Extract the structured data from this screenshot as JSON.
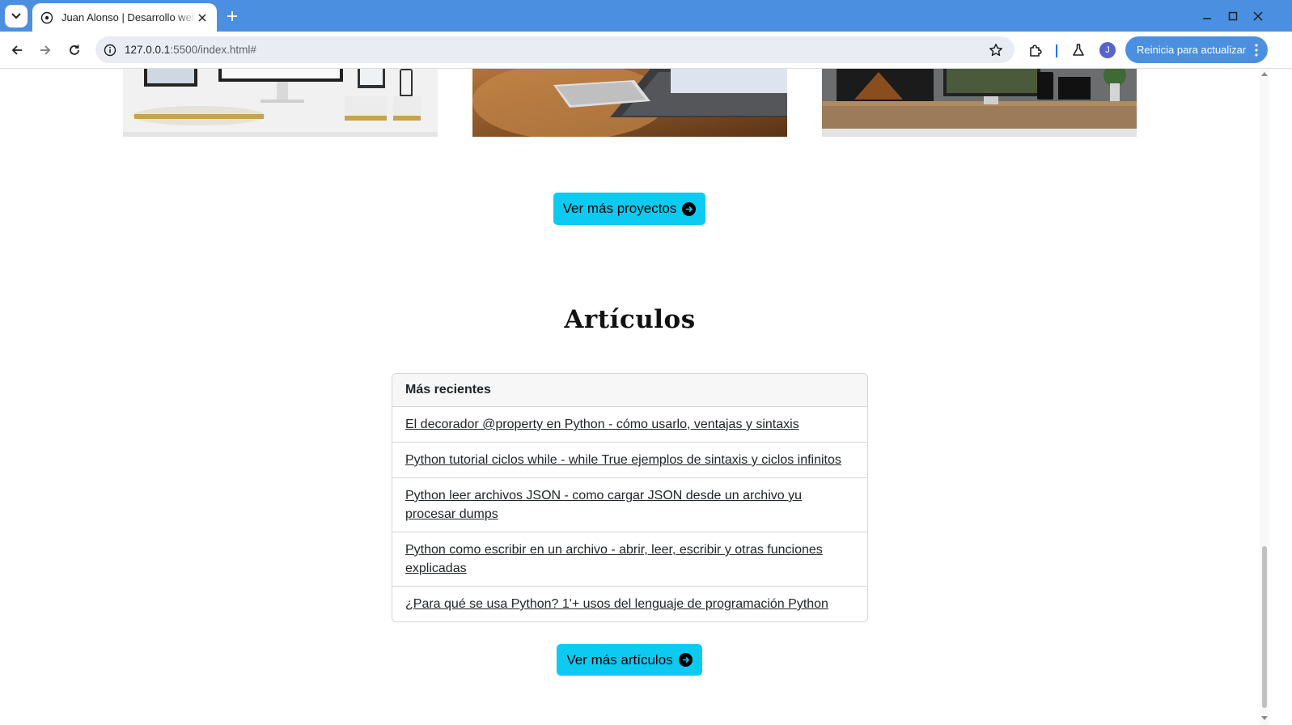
{
  "browser": {
    "tab_title": "Juan Alonso | Desarrollo web",
    "url_host": "127.0.0.1",
    "url_rest": ":5500/index.html#",
    "avatar_letter": "J",
    "update_label": "Reinicia para actualizar"
  },
  "projects": {
    "more_button": "Ver más proyectos"
  },
  "articles": {
    "title": "Artículos",
    "card_header": "Más recientes",
    "items": [
      "El decorador @property en Python - cómo usarlo, ventajas y sintaxis",
      "Python tutorial ciclos while - while True ejemplos de sintaxis y ciclos infinitos",
      "Python leer archivos JSON - como cargar JSON desde un archivo yu procesar dumps",
      "Python como escribir en un archivo - abrir, leer, escribir y otras funciones explicadas",
      "¿Para qué se usa Python? 1'+ usos del lenguaje de programación Python"
    ],
    "more_button": "Ver más artículos"
  },
  "colors": {
    "chrome_blue": "#4a8fe0",
    "button_cyan": "#0dcaf0"
  }
}
